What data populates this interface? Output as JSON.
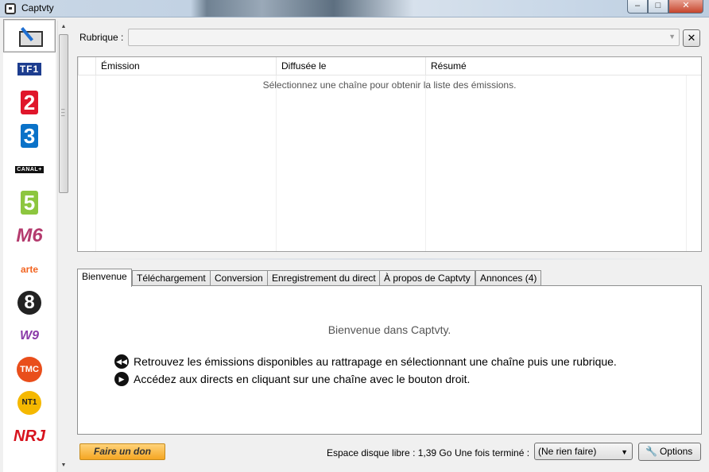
{
  "window": {
    "title": "Captvty",
    "minimize": "–",
    "maximize": "□",
    "close": "✕"
  },
  "sidebar": {
    "channels": [
      {
        "name": "editor",
        "icon": "pencil-icon",
        "selected": true
      },
      {
        "name": "TF1",
        "text": "TF1"
      },
      {
        "name": "France 2",
        "text": "2"
      },
      {
        "name": "France 3",
        "text": "3"
      },
      {
        "name": "Canal+",
        "text": "CANAL+"
      },
      {
        "name": "France 5",
        "text": "5"
      },
      {
        "name": "M6",
        "text": "M6"
      },
      {
        "name": "Arte",
        "text": "arte"
      },
      {
        "name": "D8",
        "text": "8"
      },
      {
        "name": "W9",
        "text": "W9"
      },
      {
        "name": "TMC",
        "text": "TMC"
      },
      {
        "name": "NT1",
        "text": "NT1"
      },
      {
        "name": "NRJ12",
        "text": "NRJ"
      }
    ]
  },
  "rubrique": {
    "label": "Rubrique :",
    "value": "",
    "clear": "✕"
  },
  "grid": {
    "columns": [
      "Émission",
      "Diffusée le",
      "Résumé"
    ],
    "empty_message": "Sélectionnez une chaîne pour obtenir la liste des émissions."
  },
  "tabs": [
    {
      "label": "Bienvenue",
      "active": true
    },
    {
      "label": "Téléchargement"
    },
    {
      "label": "Conversion"
    },
    {
      "label": "Enregistrement du direct"
    },
    {
      "label": "À propos de Captvty"
    },
    {
      "label": "Annonces (4)"
    }
  ],
  "welcome": {
    "title": "Bienvenue dans Captvty.",
    "lines": [
      {
        "icon": "rewind-icon",
        "text": "Retrouvez les émissions disponibles au rattrapage en sélectionnant une chaîne puis une rubrique."
      },
      {
        "icon": "play-icon",
        "text": "Accédez aux directs en cliquant sur une chaîne avec le bouton droit."
      }
    ]
  },
  "footer": {
    "donate": "Faire un don",
    "disk_space": "Espace disque libre : 1,39 Go",
    "finish_label": "Une fois terminé :",
    "finish_value": "(Ne rien faire)",
    "options": "Options"
  }
}
